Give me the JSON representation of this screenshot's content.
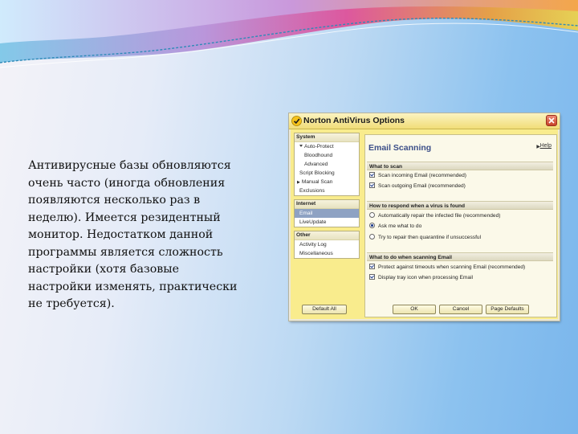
{
  "colors": {
    "accent": "#3b4e88",
    "window_bg": "#f9ec8d",
    "title_bar": "#f1dd78",
    "selected_item": "#8ea2c3",
    "close_button": "#c7422a"
  },
  "slide": {
    "body_text": "Антивирусные базы обновляются очень часто (иногда обновления появляются несколько раз в неделю). Имеется резидентный монитор. Недостатком данной программы является сложность настройки (хотя базовые настройки изменять, практически не требуется)."
  },
  "window": {
    "title": "Norton AntiVirus Options",
    "logo_icon": "norton-logo-icon",
    "close_icon": "close-icon"
  },
  "sidebar": {
    "groups": [
      {
        "header": "System",
        "items": [
          {
            "label": "Auto-Protect",
            "expanded": true
          },
          {
            "label": "Bloodhound"
          },
          {
            "label": "Advanced"
          },
          {
            "label": "Script Blocking"
          },
          {
            "label": "Manual Scan",
            "collapsed": true
          },
          {
            "label": "Exclusions"
          }
        ]
      },
      {
        "header": "Internet",
        "items": [
          {
            "label": "Email",
            "selected": true
          },
          {
            "label": "LiveUpdate"
          }
        ]
      },
      {
        "header": "Other",
        "items": [
          {
            "label": "Activity Log"
          },
          {
            "label": "Miscellaneous"
          }
        ]
      }
    ],
    "default_all_label": "Default All"
  },
  "panel": {
    "title": "Email Scanning",
    "help_label": "Help",
    "sections": [
      {
        "header": "What to scan",
        "options": [
          {
            "type": "checkbox",
            "checked": true,
            "label": "Scan incoming Email (recommended)"
          },
          {
            "type": "checkbox",
            "checked": true,
            "label": "Scan outgoing Email (recommended)"
          }
        ]
      },
      {
        "header": "How to respond when a virus is found",
        "options": [
          {
            "type": "radio",
            "checked": false,
            "label": "Automatically repair the infected file (recommended)"
          },
          {
            "type": "radio",
            "checked": true,
            "label": "Ask me what to do"
          },
          {
            "type": "radio",
            "checked": false,
            "label": "Try to repair then quarantine if unsuccessful"
          }
        ]
      },
      {
        "header": "What to do when scanning Email",
        "options": [
          {
            "type": "checkbox",
            "checked": true,
            "label": "Protect against timeouts when scanning Email (recommended)"
          },
          {
            "type": "checkbox",
            "checked": true,
            "label": "Display tray icon when processing Email"
          }
        ]
      }
    ]
  },
  "buttons": {
    "ok": "OK",
    "cancel": "Cancel",
    "page_defaults": "Page Defaults"
  }
}
